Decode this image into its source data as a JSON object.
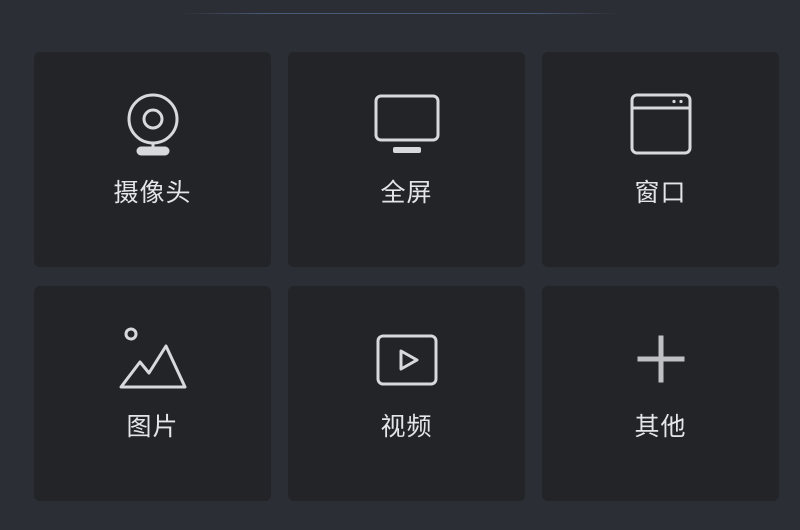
{
  "tiles": [
    {
      "label": "摄像头",
      "icon": "webcam-icon"
    },
    {
      "label": "全屏",
      "icon": "monitor-icon"
    },
    {
      "label": "窗口",
      "icon": "window-icon"
    },
    {
      "label": "图片",
      "icon": "image-icon"
    },
    {
      "label": "视频",
      "icon": "video-play-icon"
    },
    {
      "label": "其他",
      "icon": "plus-icon"
    }
  ],
  "colors": {
    "background": "#2c2e35",
    "tile": "#232428",
    "icon": "#d8d9dc",
    "text": "#e4e5e8"
  }
}
